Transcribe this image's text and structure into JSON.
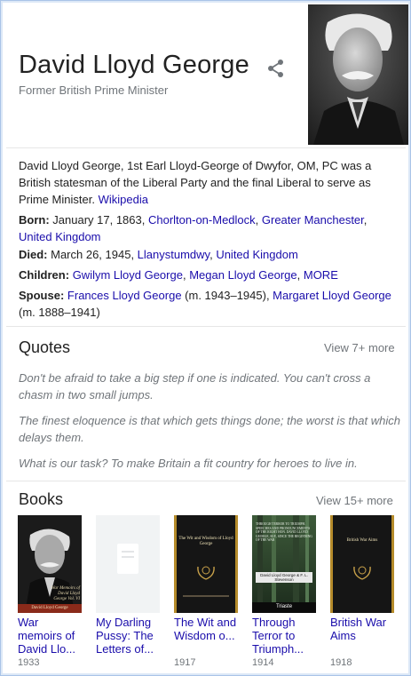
{
  "header": {
    "title": "David Lloyd George",
    "subtitle": "Former British Prime Minister"
  },
  "description": {
    "text": "David Lloyd George, 1st Earl Lloyd-George of Dwyfor, OM, PC was a British statesman of the Liberal Party and the final Liberal to serve as Prime Minister. ",
    "source_link": "Wikipedia"
  },
  "facts": {
    "born": {
      "label": "Born:",
      "text": " January 17, 1863, ",
      "link1": "Chorlton-on-Medlock",
      "sep": ", ",
      "link2": "Greater Manchester",
      "sep2": ", ",
      "link3": "United Kingdom"
    },
    "died": {
      "label": "Died:",
      "text": " March 26, 1945, ",
      "link1": "Llanystumdwy",
      "sep": ", ",
      "link2": "United Kingdom"
    },
    "children": {
      "label": "Children:",
      "link1": "Gwilym Lloyd George",
      "sep": ", ",
      "link2": "Megan Lloyd George",
      "sep2": ", ",
      "link3": "MORE"
    },
    "spouse": {
      "label": "Spouse:",
      "link1": "Frances Lloyd George",
      "text1": " (m. 1943–1945), ",
      "link2": "Margaret Lloyd George",
      "text2": " (m. 1888–1941)"
    }
  },
  "quotes": {
    "title": "Quotes",
    "view_more": "View 7+ more",
    "items": [
      "Don't be afraid to take a big step if one is indicated. You can't cross a chasm in two small jumps.",
      "The finest eloquence is that which gets things done; the worst is that which delays them.",
      "What is our task? To make Britain a fit country for heroes to live in."
    ]
  },
  "books": {
    "title": "Books",
    "view_more": "View 15+ more",
    "items": [
      {
        "title": "War memoirs of David Llo...",
        "year": "1933",
        "cover_text": "War Memoirs of David Lloyd George Vol. VI",
        "cover_author": "David Lloyd George"
      },
      {
        "title": "My Darling Pussy: The Letters of...",
        "year": ""
      },
      {
        "title": "The Wit and Wisdom o...",
        "year": "1917",
        "cover_text": "The Wit and Wisdom of Lloyd George"
      },
      {
        "title": "Through Terror to Triumph...",
        "year": "1914",
        "cover_text": "THROUGH TERROR TO TRIUMPH. SPEECHES AND PRONOUNCEMENTS OF THE RIGHT HON. DAVID LLOYD GEORGE, M.P., SINCE THE BEGINNING OF THE WAR",
        "cover_author": "David Lloyd George & F. L. Stevenson",
        "cover_publisher": "Triaste"
      },
      {
        "title": "British War Aims",
        "year": "1918",
        "cover_text": "British War Aims"
      }
    ]
  }
}
